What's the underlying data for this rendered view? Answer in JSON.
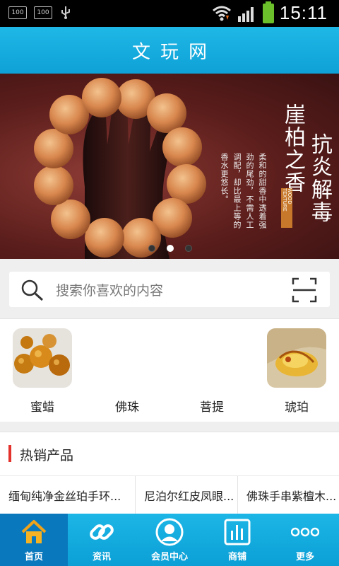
{
  "status_bar": {
    "notif_left_1": "100",
    "notif_left_2": "100",
    "time": "15:11"
  },
  "header": {
    "title": "文玩网"
  },
  "banner": {
    "title_line_1": "崖柏之香",
    "title_line_2": "抗炎解毒",
    "tag": "WOOD TEXTURE",
    "body_lines": [
      "柔和的甜香中透着强",
      "劲的尾劲，不需人工",
      "调配，却比最上等的",
      "香水更悠长。"
    ],
    "slide_count": 3,
    "active_slide": 2
  },
  "search": {
    "placeholder": "搜索你喜欢的内容"
  },
  "categories": [
    {
      "label": "蜜蜡",
      "icon": "amber-beads-image"
    },
    {
      "label": "佛珠",
      "icon": ""
    },
    {
      "label": "菩提",
      "icon": ""
    },
    {
      "label": "琥珀",
      "icon": "amber-carving-image"
    }
  ],
  "hot_section": {
    "title": "热销产品",
    "products": [
      "缅甸纯净金丝珀手环...",
      "尼泊尔红皮凤眼...",
      "佛珠手串紫檀木..."
    ]
  },
  "bottom_nav": [
    {
      "label": "首页",
      "icon": "home-icon",
      "active": true
    },
    {
      "label": "资讯",
      "icon": "link-icon",
      "active": false
    },
    {
      "label": "会员中心",
      "icon": "user-icon",
      "active": false
    },
    {
      "label": "商铺",
      "icon": "chart-icon",
      "active": false
    },
    {
      "label": "更多",
      "icon": "more-icon",
      "active": false
    }
  ],
  "colors": {
    "accent": "#0ea1d7",
    "active_tab": "#0a78bd",
    "hot_marker": "#e3322c"
  }
}
